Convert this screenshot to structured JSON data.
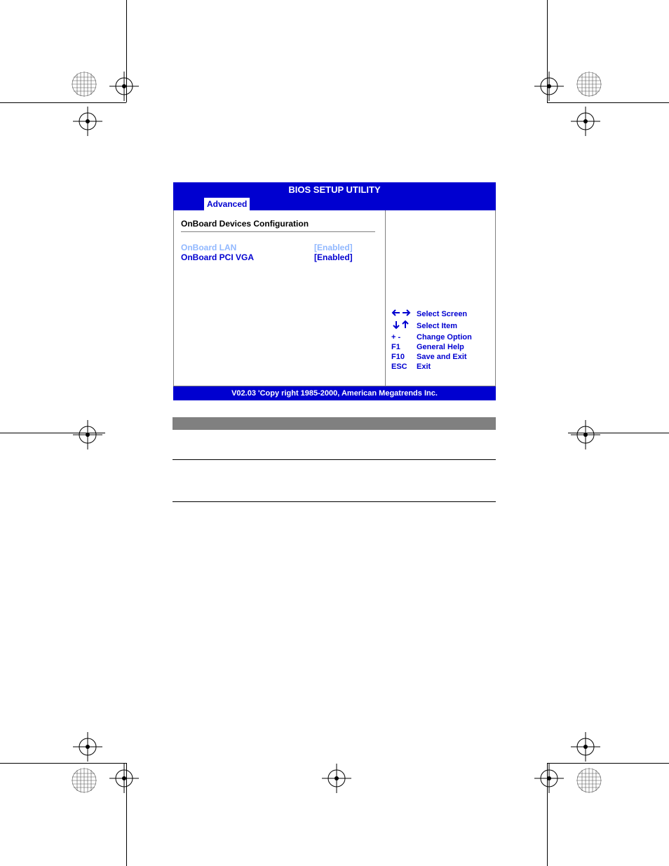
{
  "bios": {
    "title": "BIOS SETUP UTILITY",
    "tab": "Advanced",
    "section": "OnBoard Devices Configuration",
    "settings": [
      {
        "name": "OnBoard LAN",
        "value": "[Enabled]",
        "selected": true
      },
      {
        "name": "OnBoard PCI VGA",
        "value": "[Enabled]",
        "selected": false
      }
    ],
    "help": [
      {
        "key_icon": "lr",
        "key_text": "",
        "label": "Select Screen"
      },
      {
        "key_icon": "ud",
        "key_text": "",
        "label": "Select Item"
      },
      {
        "key_icon": "",
        "key_text": "+ -",
        "label": "Change Option"
      },
      {
        "key_icon": "",
        "key_text": "F1",
        "label": "General Help"
      },
      {
        "key_icon": "",
        "key_text": "F10",
        "label": "Save and Exit"
      },
      {
        "key_icon": "",
        "key_text": "ESC",
        "label": "Exit"
      }
    ],
    "footer": "V02.03 'Copy  right 1985-2000, American Megatrends Inc."
  }
}
